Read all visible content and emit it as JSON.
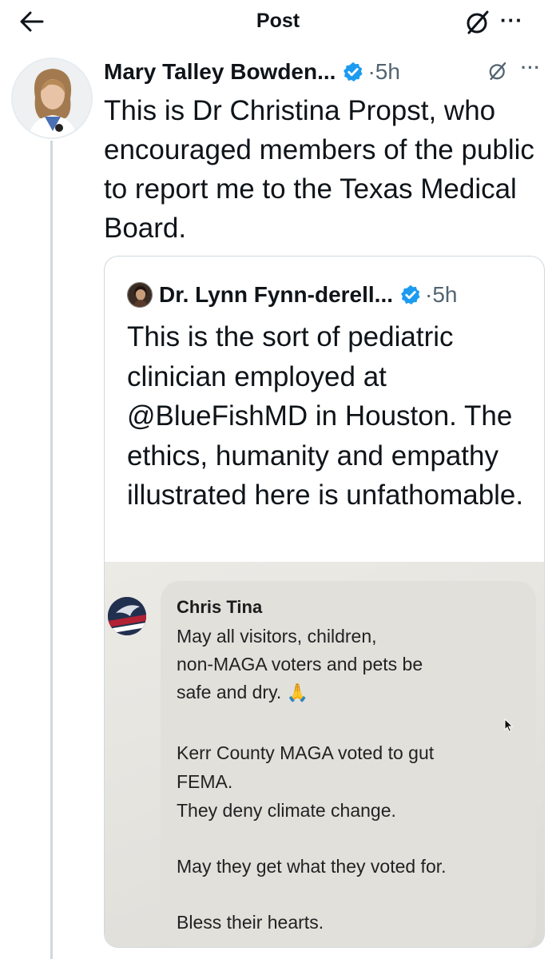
{
  "topbar": {
    "back_icon": "arrow-left-icon",
    "title": "Post",
    "grok_icon": "grok-icon",
    "more_icon": "more-horizontal-icon",
    "more_label": "···"
  },
  "post": {
    "author_name": "Mary Talley Bowden...",
    "verified_icon": "verified-badge-icon",
    "time": "·5h",
    "more_label": "···",
    "text": "This is Dr Christina Propst, who encouraged members of the public to report me to the Texas Medical Board."
  },
  "quote": {
    "author_name": "Dr. Lynn Fynn-derell...",
    "time": "·5h",
    "text": "This is the sort of pediatric clinician employed at @BlueFishMD in Houston. The ethics, humanity and empathy illustrated here is unfathomable.",
    "image": {
      "commenter_name": "Chris Tina",
      "lines": [
        "May all visitors, children,",
        "non-MAGA voters and pets be",
        "safe and dry.",
        "",
        "Kerr County MAGA voted to gut",
        "FEMA.",
        "They deny climate change.",
        "",
        "May they get what they voted for.",
        "",
        "Bless their hearts."
      ],
      "emoji": "🙏"
    }
  },
  "colors": {
    "text": "#0f1419",
    "secondary": "#536471",
    "verified": "#1d9bf0",
    "border": "#cfd9de"
  }
}
